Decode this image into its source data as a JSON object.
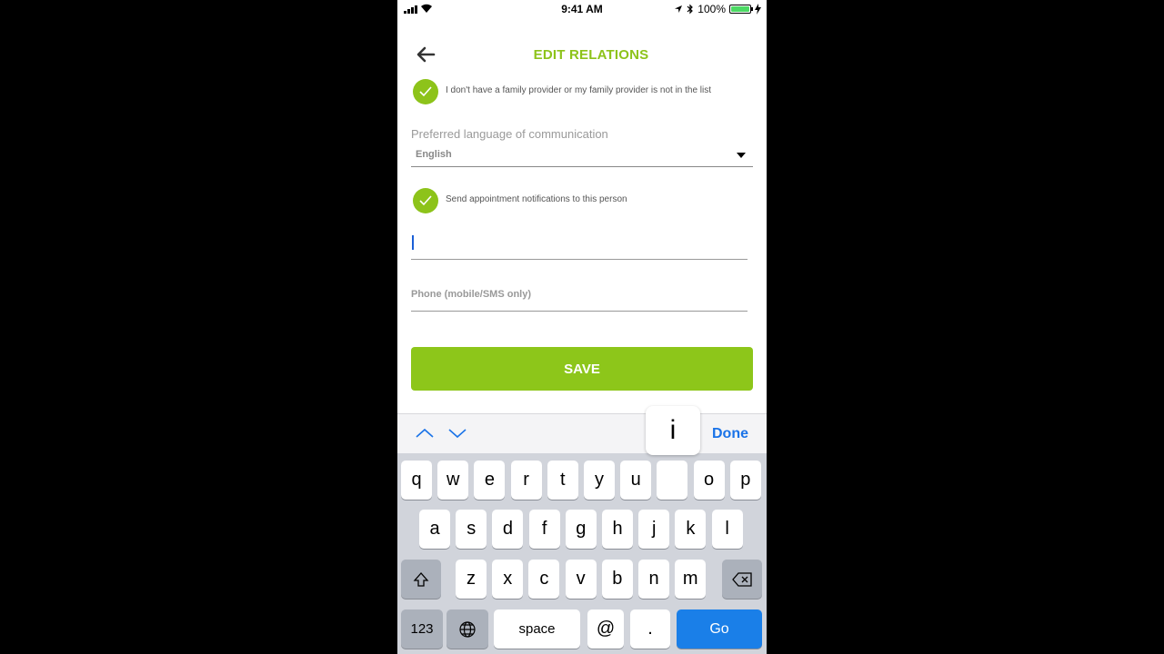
{
  "status_bar": {
    "time": "9:41 AM",
    "battery": "100%",
    "battery_level": 1.0
  },
  "header": {
    "title": "EDIT RELATIONS"
  },
  "family_provider_check": {
    "checked": true,
    "label": "I don't have a family provider or my family provider is not in the list"
  },
  "language": {
    "label": "Preferred language of communication",
    "value": "English"
  },
  "notifications_check": {
    "checked": true,
    "label": "Send appointment notifications to this person"
  },
  "fields": {
    "name": {
      "value": "",
      "placeholder": ""
    },
    "phone": {
      "value": "",
      "placeholder": "Phone (mobile/SMS only)"
    }
  },
  "save_label": "SAVE",
  "keyboard": {
    "done_label": "Done",
    "popup_key": "i",
    "row1": [
      "q",
      "w",
      "e",
      "r",
      "t",
      "y",
      "u",
      "i",
      "o",
      "p"
    ],
    "row2": [
      "a",
      "s",
      "d",
      "f",
      "g",
      "h",
      "j",
      "k",
      "l"
    ],
    "row3": [
      "z",
      "x",
      "c",
      "v",
      "b",
      "n",
      "m"
    ],
    "numbers_label": "123",
    "space_label": "space",
    "at_label": "@",
    "dot_label": ".",
    "go_label": "Go"
  },
  "colors": {
    "accent": "#8dc31a",
    "save_button": "#8dc61a",
    "keyboard_blue": "#1a7fe8"
  }
}
